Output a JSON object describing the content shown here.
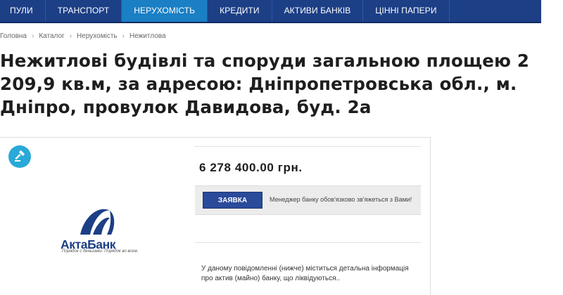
{
  "nav": {
    "items": [
      {
        "label": "ПУЛИ",
        "active": false
      },
      {
        "label": "ТРАНСПОРТ",
        "active": false
      },
      {
        "label": "НЕРУХОМІСТЬ",
        "active": true
      },
      {
        "label": "КРЕДИТИ",
        "active": false
      },
      {
        "label": "АКТИВИ БАНКІВ",
        "active": false
      },
      {
        "label": "ЦІННІ ПАПЕРИ",
        "active": false
      }
    ]
  },
  "breadcrumb": {
    "items": [
      "Головна",
      "Каталог",
      "Нерухомість",
      "Нежитлова"
    ],
    "separator": "›"
  },
  "title": "Нежитлові будівлі та споруди загальною площею 2 209,9 кв.м, за адресою: Дніпропетровська обл., м. Дніпро, провулок Давидова, буд. 2а",
  "lot": {
    "price": "6 278 400.00 грн.",
    "request_button": "ЗАЯВКА",
    "manager_note": "Менеджер банку обов'язково зв'яжеться з Вами!",
    "info": "У даному повідомленні (нижче) міститься детальна інформація про актив (майно) банку, що ліквідуються.."
  },
  "bank": {
    "name": "АктаБанк",
    "slogan": "Порядок с деньгами. Порядок во всем."
  },
  "colors": {
    "nav_bg": "#1c3f86",
    "nav_active": "#1a7fc4",
    "button": "#2a4a9a",
    "badge": "#29a9d8"
  },
  "icons": {
    "auction": "gavel-icon"
  }
}
